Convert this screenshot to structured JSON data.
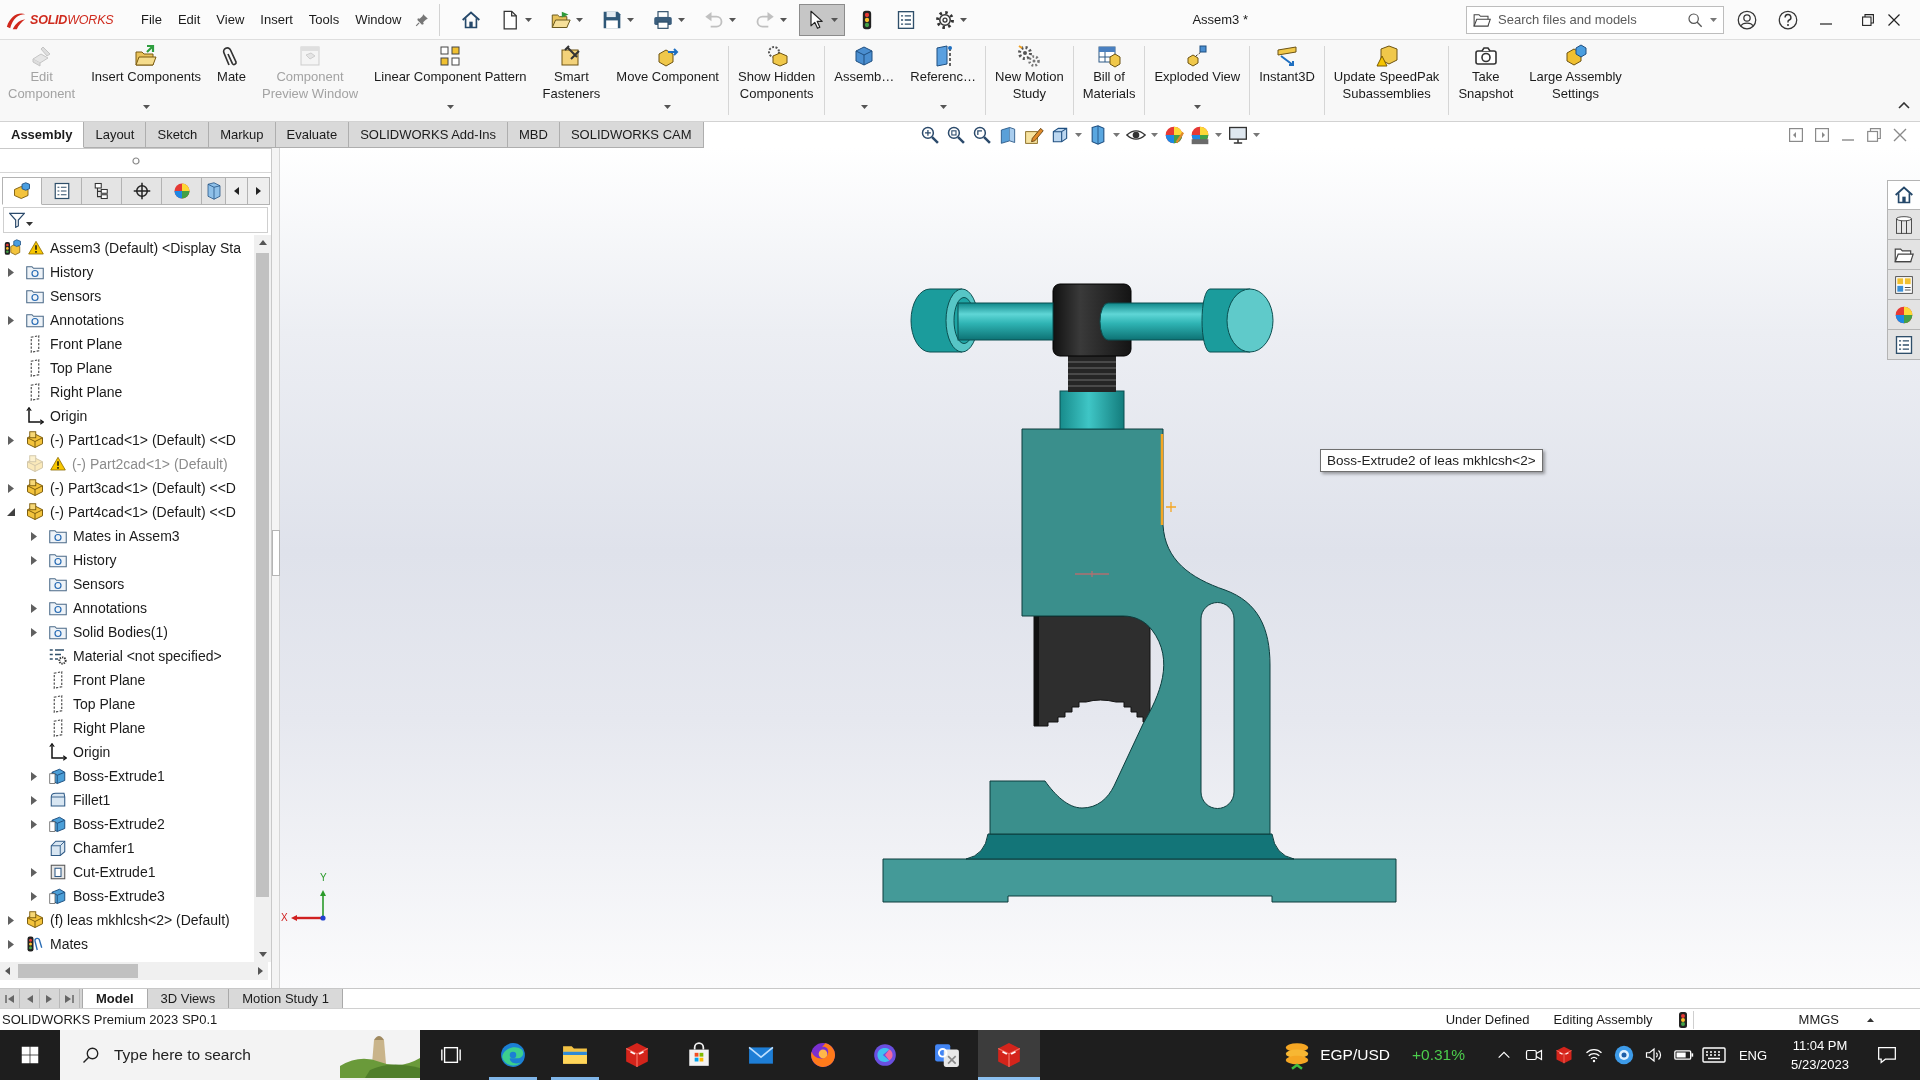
{
  "title_bar": {
    "logo": "**SOLID**WORKS",
    "menus": [
      "File",
      "Edit",
      "View",
      "Insert",
      "Tools",
      "Window"
    ],
    "quick_access": [
      {
        "dropdown": false,
        "disabled": false,
        "pressed": false
      },
      {
        "dropdown": true,
        "disabled": false,
        "pressed": false
      },
      {
        "dropdown": true,
        "disabled": false,
        "pressed": false
      },
      {
        "dropdown": true,
        "disabled": false,
        "pressed": false
      },
      {
        "dropdown": true,
        "disabled": false,
        "pressed": false
      },
      {
        "dropdown": true,
        "disabled": true,
        "pressed": false
      },
      {
        "dropdown": true,
        "disabled": true,
        "pressed": false
      },
      {
        "dropdown": true,
        "disabled": false,
        "pressed": true
      },
      {
        "dropdown": false,
        "disabled": false,
        "pressed": false
      },
      {
        "dropdown": false,
        "disabled": false,
        "pressed": false
      },
      {
        "dropdown": true,
        "disabled": false,
        "pressed": false
      }
    ],
    "document_title": "Assem3 *",
    "search": {
      "placeholder": "Search files and models"
    }
  },
  "command_manager": {
    "groups": [
      [
        {
          "lines": [
            "Edit",
            "Component"
          ],
          "disabled": true,
          "dropdown": false
        },
        {
          "lines": [
            "Insert Components"
          ],
          "disabled": false,
          "dropdown": true
        },
        {
          "lines": [
            "Mate"
          ],
          "disabled": false,
          "dropdown": false
        },
        {
          "lines": [
            "Component",
            "Preview Window"
          ],
          "disabled": true,
          "dropdown": false
        },
        {
          "lines": [
            "Linear Component Pattern"
          ],
          "disabled": false,
          "dropdown": true
        },
        {
          "lines": [
            "Smart",
            "Fasteners"
          ],
          "disabled": false,
          "dropdown": false
        },
        {
          "lines": [
            "Move Component"
          ],
          "disabled": false,
          "dropdown": true
        }
      ],
      [
        {
          "lines": [
            "Show Hidden",
            "Components"
          ],
          "disabled": false,
          "dropdown": false
        }
      ],
      [
        {
          "lines": [
            "Assemb…"
          ],
          "disabled": false,
          "dropdown": true
        },
        {
          "lines": [
            "Referenc…"
          ],
          "disabled": false,
          "dropdown": true
        }
      ],
      [
        {
          "lines": [
            "New Motion",
            "Study"
          ],
          "disabled": false,
          "dropdown": false
        }
      ],
      [
        {
          "lines": [
            "Bill of",
            "Materials"
          ],
          "disabled": false,
          "dropdown": false
        }
      ],
      [
        {
          "lines": [
            "Exploded View"
          ],
          "disabled": false,
          "dropdown": true
        }
      ],
      [
        {
          "lines": [
            "Instant3D"
          ],
          "disabled": false,
          "dropdown": false
        }
      ],
      [
        {
          "lines": [
            "Update SpeedPak",
            "Subassemblies"
          ],
          "disabled": false,
          "dropdown": false
        }
      ],
      [
        {
          "lines": [
            "Take",
            "Snapshot"
          ],
          "disabled": false,
          "dropdown": false
        },
        {
          "lines": [
            "Large Assembly",
            "Settings"
          ],
          "disabled": false,
          "dropdown": false
        }
      ]
    ]
  },
  "command_tabs": [
    {
      "label": "Assembly",
      "selected": true
    },
    {
      "label": "Layout",
      "selected": false
    },
    {
      "label": "Sketch",
      "selected": false
    },
    {
      "label": "Markup",
      "selected": false
    },
    {
      "label": "Evaluate",
      "selected": false
    },
    {
      "label": "SOLIDWORKS Add-Ins",
      "selected": false
    },
    {
      "label": "MBD",
      "selected": false
    },
    {
      "label": "SOLIDWORKS CAM",
      "selected": false
    }
  ],
  "feature_manager": {
    "tabs": [
      {
        "selected": true
      },
      {
        "selected": false
      },
      {
        "selected": false
      },
      {
        "selected": false
      },
      {
        "selected": false
      },
      {
        "selected": false
      }
    ],
    "tree": {
      "label": "Assem3 (Default) <Display Sta",
      "warning": true,
      "children": [
        {
          "label": "History",
          "kind": "folder",
          "expanded": false,
          "suppressed": false,
          "warning": false
        },
        {
          "label": "Sensors",
          "kind": "folder",
          "suppressed": false,
          "warning": false
        },
        {
          "label": "Annotations",
          "kind": "folder",
          "expanded": false,
          "suppressed": false,
          "warning": false
        },
        {
          "label": "Front Plane",
          "kind": "plane",
          "suppressed": false,
          "warning": false
        },
        {
          "label": "Top Plane",
          "kind": "plane",
          "suppressed": false,
          "warning": false
        },
        {
          "label": "Right Plane",
          "kind": "plane",
          "suppressed": false,
          "warning": false
        },
        {
          "label": "Origin",
          "kind": "origin",
          "suppressed": false,
          "warning": false
        },
        {
          "label": "(-) Part1cad<1> (Default) <<D",
          "kind": "part",
          "expanded": false,
          "suppressed": false,
          "warning": false
        },
        {
          "label": "(-) Part2cad<1> (Default)",
          "kind": "part",
          "suppressed": true,
          "warning": true
        },
        {
          "label": "(-) Part3cad<1> (Default) <<D",
          "kind": "part",
          "expanded": false,
          "suppressed": false,
          "warning": false
        },
        {
          "label": "(-) Part4cad<1> (Default) <<D",
          "kind": "part",
          "expanded": true,
          "suppressed": false,
          "warning": false,
          "children": [
            {
              "label": "Mates in Assem3",
              "kind": "folder",
              "expanded": false,
              "suppressed": false,
              "warning": false
            },
            {
              "label": "History",
              "kind": "folder",
              "expanded": false,
              "suppressed": false,
              "warning": false
            },
            {
              "label": "Sensors",
              "kind": "folder",
              "suppressed": false,
              "warning": false
            },
            {
              "label": "Annotations",
              "kind": "folder",
              "expanded": false,
              "suppressed": false,
              "warning": false
            },
            {
              "label": "Solid Bodies(1)",
              "kind": "folder",
              "expanded": false,
              "suppressed": false,
              "warning": false
            },
            {
              "label": "Material <not specified>",
              "kind": "material",
              "suppressed": false,
              "warning": false
            },
            {
              "label": "Front Plane",
              "kind": "plane",
              "suppressed": false,
              "warning": false
            },
            {
              "label": "Top Plane",
              "kind": "plane",
              "suppressed": false,
              "warning": false
            },
            {
              "label": "Right Plane",
              "kind": "plane",
              "suppressed": false,
              "warning": false
            },
            {
              "label": "Origin",
              "kind": "origin",
              "suppressed": false,
              "warning": false
            },
            {
              "label": "Boss-Extrude1",
              "kind": "feature",
              "expanded": false,
              "suppressed": false,
              "warning": false
            },
            {
              "label": "Fillet1",
              "kind": "fillet",
              "expanded": false,
              "suppressed": false,
              "warning": false
            },
            {
              "label": "Boss-Extrude2",
              "kind": "feature",
              "expanded": false,
              "suppressed": false,
              "warning": false
            },
            {
              "label": "Chamfer1",
              "kind": "chamfer",
              "suppressed": false,
              "warning": false
            },
            {
              "label": "Cut-Extrude1",
              "kind": "cut",
              "expanded": false,
              "suppressed": false,
              "warning": false
            },
            {
              "label": "Boss-Extrude3",
              "kind": "feature",
              "expanded": false,
              "suppressed": false,
              "warning": false
            }
          ]
        },
        {
          "label": "(f) leas mkhlcsh<2> (Default)",
          "kind": "part",
          "expanded": false,
          "suppressed": false,
          "warning": false
        },
        {
          "label": "Mates",
          "kind": "mates",
          "expanded": false,
          "suppressed": false,
          "warning": false
        }
      ]
    }
  },
  "viewport": {
    "view_toolbar": [
      {
        "dropdown": false
      },
      {
        "dropdown": false
      },
      {
        "dropdown": false
      },
      {
        "dropdown": false
      },
      {
        "dropdown": false
      },
      {
        "dropdown": true
      },
      {
        "dropdown": true
      },
      {
        "dropdown": true
      },
      {
        "dropdown": false
      },
      {
        "dropdown": true
      },
      {
        "dropdown": true
      }
    ],
    "task_pane": [
      {
        "selected": true
      },
      {
        "selected": false
      },
      {
        "selected": false
      },
      {
        "selected": false
      },
      {
        "selected": false
      },
      {
        "selected": false
      }
    ],
    "tooltip": "Boss-Extrude2 of leas mkhlcsh<2>",
    "triad": {
      "y_label": "Y",
      "x_label": "X"
    }
  },
  "model_tabs": [
    {
      "label": "Model",
      "selected": true
    },
    {
      "label": "3D Views",
      "selected": false
    },
    {
      "label": "Motion Study 1",
      "selected": false
    }
  ],
  "status_bar": {
    "product": "SOLIDWORKS Premium 2023 SP0.1",
    "sketch_state": "Under Defined",
    "mode": "Editing Assembly",
    "units": "MMGS"
  },
  "taskbar": {
    "search": {
      "placeholder": "Type here to search"
    },
    "apps": [
      {
        "running": true,
        "active": false
      },
      {
        "running": true,
        "active": false
      },
      {
        "running": false,
        "active": false
      },
      {
        "running": false,
        "active": false
      },
      {
        "running": false,
        "active": false
      },
      {
        "running": false,
        "active": false
      },
      {
        "running": false,
        "active": false
      },
      {
        "running": false,
        "active": false
      },
      {
        "running": true,
        "active": true
      }
    ],
    "ticker": {
      "symbol": "EGP/USD",
      "change": "+0.31%"
    },
    "language": "ENG",
    "time": "11:04 PM",
    "date": "5/23/2023"
  }
}
